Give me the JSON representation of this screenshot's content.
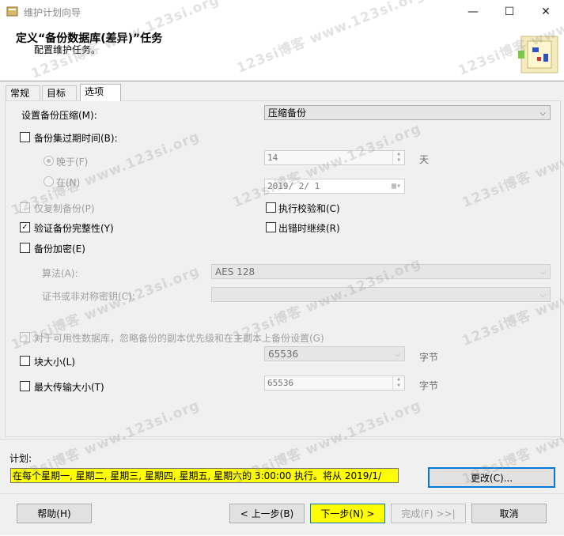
{
  "window": {
    "title": "维护计划向导",
    "header_title": "定义“备份数据库(差异)”任务",
    "header_subtitle": "配置维护任务。"
  },
  "tabs": [
    {
      "label": "常规",
      "active": false
    },
    {
      "label": "目标",
      "active": false
    },
    {
      "label": "选项",
      "active": true
    }
  ],
  "options": {
    "compression_label": "设置备份压缩(M):",
    "compression_value": "压缩备份",
    "expire_label": "备份集过期时间(B):",
    "after_label": "晚于(F)",
    "after_value": "14",
    "after_unit": "天",
    "on_label": "在(N)",
    "on_value": "2019/ 2/ 1",
    "copy_only_label": "仅复制备份(P)",
    "checksum_label": "执行校验和(C)",
    "verify_label": "验证备份完整性(Y)",
    "continue_on_error_label": "出错时继续(R)",
    "encrypt_label": "备份加密(E)",
    "algorithm_label": "算法(A):",
    "algorithm_value": "AES 128",
    "cert_label": "证书或非对称密钥(C):",
    "cert_value": "",
    "ag_label": "对于可用性数据库，忽略备份的副本优先级和在主副本上备份设置(G)",
    "block_size_label": "块大小(L)",
    "block_size_value": "65536",
    "block_size_unit": "字节",
    "max_transfer_label": "最大传输大小(T)",
    "max_transfer_value": "65536",
    "max_transfer_unit": "字节"
  },
  "checkbox_states": {
    "expire": false,
    "copy_only": false,
    "checksum": false,
    "verify": true,
    "continue_on_error": false,
    "encrypt": false,
    "ag": false,
    "block_size": false,
    "max_transfer": false
  },
  "schedule": {
    "label": "计划:",
    "text": "在每个星期一, 星期二, 星期三, 星期四, 星期五, 星期六的 3:00:00 执行。将从 2019/1/",
    "change_button": "更改(C)..."
  },
  "buttons": {
    "help": "帮助(H)",
    "back": "< 上一步(B)",
    "next": "下一步(N) >",
    "finish": "完成(F) >>|",
    "cancel": "取消"
  },
  "watermark": "123si博客 www.123si.org",
  "colors": {
    "schedule_highlight": "#ffff00",
    "focus_border": "#0078d7"
  }
}
